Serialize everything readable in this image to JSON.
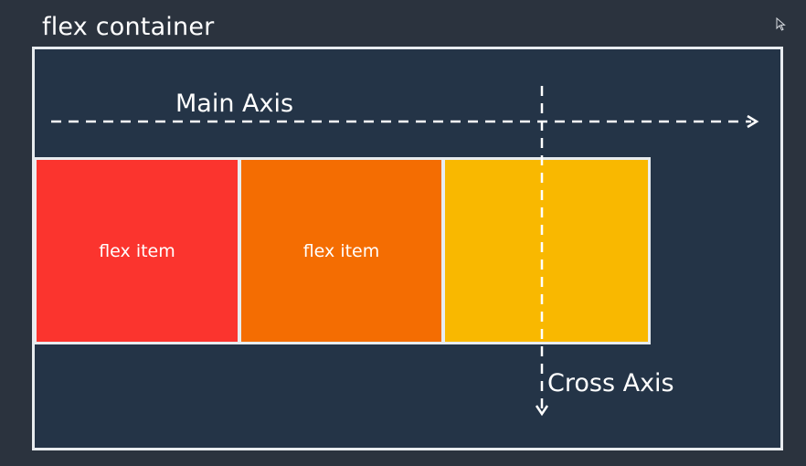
{
  "diagram": {
    "container_label": "flex container",
    "main_axis_label": "Main Axis",
    "cross_axis_label": "Cross Axis",
    "items": [
      {
        "label": "flex item",
        "color": "#fb342e"
      },
      {
        "label": "flex item",
        "color": "#f46d02"
      },
      {
        "label": "",
        "color": "#f9b800"
      }
    ],
    "colors": {
      "background": "#2b333e",
      "container_fill": "#243447",
      "border": "#e8ecef",
      "text": "#ffffff"
    }
  },
  "icons": {
    "cursor": "mouse-pointer-icon"
  }
}
